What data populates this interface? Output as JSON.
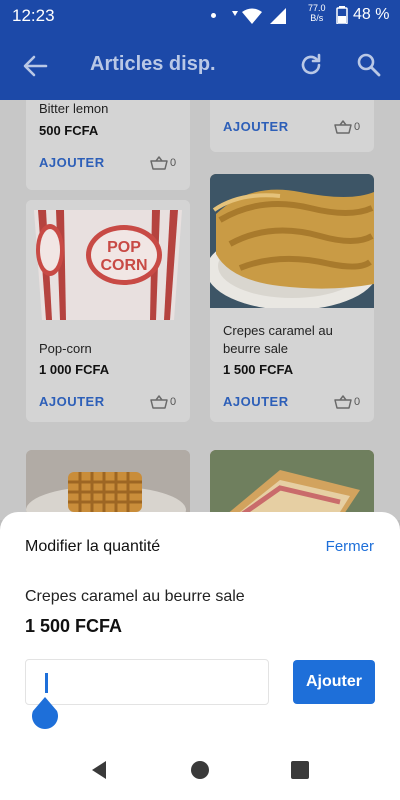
{
  "status_bar": {
    "time": "12:23",
    "net_speed_value": "77.0",
    "net_speed_unit": "B/s",
    "battery": "48 %"
  },
  "app_bar": {
    "title": "Articles disp.",
    "icons": [
      "back-arrow-icon",
      "refresh-icon",
      "search-icon"
    ]
  },
  "products": [
    {
      "name": "Bitter lemon",
      "price": "500 FCFA",
      "add_label": "AJOUTER",
      "cart_count": "0"
    },
    {
      "name": "",
      "price": "",
      "add_label": "AJOUTER",
      "cart_count": "0"
    },
    {
      "name": "Pop-corn",
      "price": "1 000 FCFA",
      "add_label": "AJOUTER",
      "cart_count": "0",
      "image_text": "POP CORN"
    },
    {
      "name": "Crepes caramel au beurre sale",
      "price": "1 500 FCFA",
      "add_label": "AJOUTER",
      "cart_count": "0"
    }
  ],
  "sheet": {
    "heading": "Modifier la quantité",
    "close_label": "Fermer",
    "product_name": "Crepes caramel au beurre sale",
    "product_price": "1 500 FCFA",
    "quantity_value": "",
    "add_button_label": "Ajouter"
  },
  "colors": {
    "app_bar": "#1c49a8",
    "accent": "#1e6fd9",
    "overlay": "#c7c7c7"
  }
}
